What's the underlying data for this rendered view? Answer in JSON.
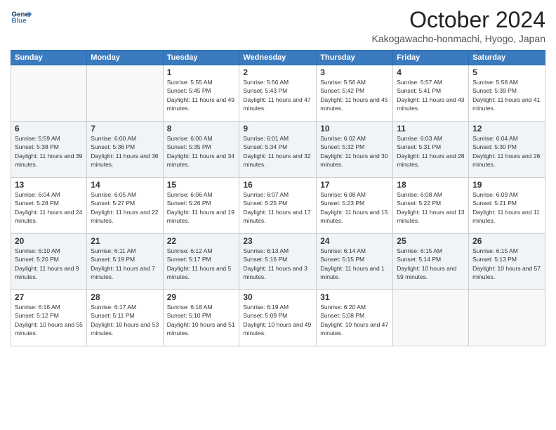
{
  "logo": {
    "line1": "General",
    "line2": "Blue"
  },
  "title": "October 2024",
  "location": "Kakogawacho-honmachi, Hyogo, Japan",
  "weekdays": [
    "Sunday",
    "Monday",
    "Tuesday",
    "Wednesday",
    "Thursday",
    "Friday",
    "Saturday"
  ],
  "weeks": [
    [
      {
        "day": "",
        "info": ""
      },
      {
        "day": "",
        "info": ""
      },
      {
        "day": "1",
        "info": "Sunrise: 5:55 AM\nSunset: 5:45 PM\nDaylight: 11 hours and 49 minutes."
      },
      {
        "day": "2",
        "info": "Sunrise: 5:56 AM\nSunset: 5:43 PM\nDaylight: 11 hours and 47 minutes."
      },
      {
        "day": "3",
        "info": "Sunrise: 5:56 AM\nSunset: 5:42 PM\nDaylight: 11 hours and 45 minutes."
      },
      {
        "day": "4",
        "info": "Sunrise: 5:57 AM\nSunset: 5:41 PM\nDaylight: 11 hours and 43 minutes."
      },
      {
        "day": "5",
        "info": "Sunrise: 5:58 AM\nSunset: 5:39 PM\nDaylight: 11 hours and 41 minutes."
      }
    ],
    [
      {
        "day": "6",
        "info": "Sunrise: 5:59 AM\nSunset: 5:38 PM\nDaylight: 11 hours and 39 minutes."
      },
      {
        "day": "7",
        "info": "Sunrise: 6:00 AM\nSunset: 5:36 PM\nDaylight: 11 hours and 36 minutes."
      },
      {
        "day": "8",
        "info": "Sunrise: 6:00 AM\nSunset: 5:35 PM\nDaylight: 11 hours and 34 minutes."
      },
      {
        "day": "9",
        "info": "Sunrise: 6:01 AM\nSunset: 5:34 PM\nDaylight: 11 hours and 32 minutes."
      },
      {
        "day": "10",
        "info": "Sunrise: 6:02 AM\nSunset: 5:32 PM\nDaylight: 11 hours and 30 minutes."
      },
      {
        "day": "11",
        "info": "Sunrise: 6:03 AM\nSunset: 5:31 PM\nDaylight: 11 hours and 28 minutes."
      },
      {
        "day": "12",
        "info": "Sunrise: 6:04 AM\nSunset: 5:30 PM\nDaylight: 11 hours and 26 minutes."
      }
    ],
    [
      {
        "day": "13",
        "info": "Sunrise: 6:04 AM\nSunset: 5:28 PM\nDaylight: 11 hours and 24 minutes."
      },
      {
        "day": "14",
        "info": "Sunrise: 6:05 AM\nSunset: 5:27 PM\nDaylight: 11 hours and 22 minutes."
      },
      {
        "day": "15",
        "info": "Sunrise: 6:06 AM\nSunset: 5:26 PM\nDaylight: 11 hours and 19 minutes."
      },
      {
        "day": "16",
        "info": "Sunrise: 6:07 AM\nSunset: 5:25 PM\nDaylight: 11 hours and 17 minutes."
      },
      {
        "day": "17",
        "info": "Sunrise: 6:08 AM\nSunset: 5:23 PM\nDaylight: 11 hours and 15 minutes."
      },
      {
        "day": "18",
        "info": "Sunrise: 6:08 AM\nSunset: 5:22 PM\nDaylight: 11 hours and 13 minutes."
      },
      {
        "day": "19",
        "info": "Sunrise: 6:09 AM\nSunset: 5:21 PM\nDaylight: 11 hours and 11 minutes."
      }
    ],
    [
      {
        "day": "20",
        "info": "Sunrise: 6:10 AM\nSunset: 5:20 PM\nDaylight: 11 hours and 9 minutes."
      },
      {
        "day": "21",
        "info": "Sunrise: 6:11 AM\nSunset: 5:19 PM\nDaylight: 11 hours and 7 minutes."
      },
      {
        "day": "22",
        "info": "Sunrise: 6:12 AM\nSunset: 5:17 PM\nDaylight: 11 hours and 5 minutes."
      },
      {
        "day": "23",
        "info": "Sunrise: 6:13 AM\nSunset: 5:16 PM\nDaylight: 11 hours and 3 minutes."
      },
      {
        "day": "24",
        "info": "Sunrise: 6:14 AM\nSunset: 5:15 PM\nDaylight: 11 hours and 1 minute."
      },
      {
        "day": "25",
        "info": "Sunrise: 6:15 AM\nSunset: 5:14 PM\nDaylight: 10 hours and 59 minutes."
      },
      {
        "day": "26",
        "info": "Sunrise: 6:15 AM\nSunset: 5:13 PM\nDaylight: 10 hours and 57 minutes."
      }
    ],
    [
      {
        "day": "27",
        "info": "Sunrise: 6:16 AM\nSunset: 5:12 PM\nDaylight: 10 hours and 55 minutes."
      },
      {
        "day": "28",
        "info": "Sunrise: 6:17 AM\nSunset: 5:11 PM\nDaylight: 10 hours and 53 minutes."
      },
      {
        "day": "29",
        "info": "Sunrise: 6:18 AM\nSunset: 5:10 PM\nDaylight: 10 hours and 51 minutes."
      },
      {
        "day": "30",
        "info": "Sunrise: 6:19 AM\nSunset: 5:09 PM\nDaylight: 10 hours and 49 minutes."
      },
      {
        "day": "31",
        "info": "Sunrise: 6:20 AM\nSunset: 5:08 PM\nDaylight: 10 hours and 47 minutes."
      },
      {
        "day": "",
        "info": ""
      },
      {
        "day": "",
        "info": ""
      }
    ]
  ]
}
